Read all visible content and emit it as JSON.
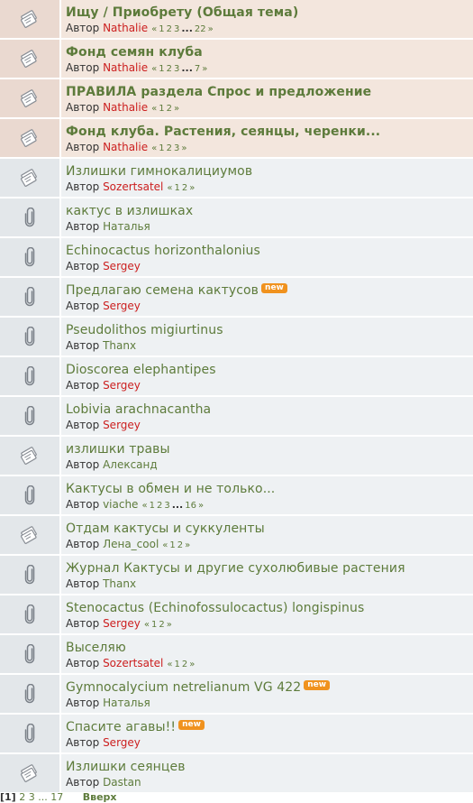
{
  "topics": [
    {
      "type": "sticky",
      "icon": "topic-sticky-icon",
      "title": "Ищу / Приобрету (Общая тема)",
      "author_label": "Автор",
      "author": "Nathalie",
      "author_color": "#cc1f1f",
      "pages": [
        "«",
        "1",
        "2",
        "3",
        "...",
        "22",
        "»"
      ],
      "badge": ""
    },
    {
      "type": "sticky",
      "icon": "topic-sticky-icon",
      "title": "Фонд семян клуба",
      "author_label": "Автор",
      "author": "Nathalie",
      "author_color": "#cc1f1f",
      "pages": [
        "«",
        "1",
        "2",
        "3",
        "...",
        "7",
        "»"
      ],
      "badge": ""
    },
    {
      "type": "sticky",
      "icon": "topic-sticky-icon",
      "title": "ПРАВИЛА раздела Спрос и предложение",
      "author_label": "Автор",
      "author": "Nathalie",
      "author_color": "#cc1f1f",
      "pages": [
        "«",
        "1",
        "2",
        "»"
      ],
      "badge": ""
    },
    {
      "type": "sticky",
      "icon": "topic-sticky-icon",
      "title": "Фонд клуба. Растения, сеянцы, черенки...",
      "author_label": "Автор",
      "author": "Nathalie",
      "author_color": "#cc1f1f",
      "pages": [
        "«",
        "1",
        "2",
        "3",
        "»"
      ],
      "badge": ""
    },
    {
      "type": "normal",
      "icon": "topic-multipage-icon",
      "title": "Излишки гимнокалициумов",
      "author_label": "Автор",
      "author": "Sozertsatel",
      "author_color": "#cc1f1f",
      "pages": [
        "«",
        "1",
        "2",
        "»"
      ],
      "badge": ""
    },
    {
      "type": "normal",
      "icon": "paperclip-icon",
      "title": "кактус в излишках",
      "author_label": "Автор",
      "author": "Наталья",
      "author_color": "#5d7b3b",
      "pages": [],
      "badge": ""
    },
    {
      "type": "normal",
      "icon": "paperclip-icon",
      "title": "Echinocactus horizonthalonius",
      "author_label": "Автор",
      "author": "Sergey",
      "author_color": "#cc1f1f",
      "pages": [],
      "badge": ""
    },
    {
      "type": "normal",
      "icon": "paperclip-icon",
      "title": "Предлагаю семена кактусов",
      "author_label": "Автор",
      "author": "Sergey",
      "author_color": "#cc1f1f",
      "pages": [],
      "badge": "new"
    },
    {
      "type": "normal",
      "icon": "paperclip-icon",
      "title": "Pseudolithos migiurtinus",
      "author_label": "Автор",
      "author": "Thanx",
      "author_color": "#5d7b3b",
      "pages": [],
      "badge": ""
    },
    {
      "type": "normal",
      "icon": "paperclip-icon",
      "title": "Dioscorea elephantipes",
      "author_label": "Автор",
      "author": "Sergey",
      "author_color": "#cc1f1f",
      "pages": [],
      "badge": ""
    },
    {
      "type": "normal",
      "icon": "paperclip-icon",
      "title": "Lobivia arachnacantha",
      "author_label": "Автор",
      "author": "Sergey",
      "author_color": "#cc1f1f",
      "pages": [],
      "badge": ""
    },
    {
      "type": "normal",
      "icon": "topic-multipage-icon",
      "title": "излишки травы",
      "author_label": "Автор",
      "author": "Александ",
      "author_color": "#5d7b3b",
      "pages": [],
      "badge": ""
    },
    {
      "type": "normal",
      "icon": "paperclip-icon",
      "title": "Кактусы в обмен и не только...",
      "author_label": "Автор",
      "author": "viache",
      "author_color": "#5d7b3b",
      "pages": [
        "«",
        "1",
        "2",
        "3",
        "...",
        "16",
        "»"
      ],
      "badge": ""
    },
    {
      "type": "normal",
      "icon": "topic-multipage-icon",
      "title": "Отдам кактусы и суккуленты",
      "author_label": "Автор",
      "author": "Лена_cool",
      "author_color": "#5d7b3b",
      "pages": [
        "«",
        "1",
        "2",
        "»"
      ],
      "badge": ""
    },
    {
      "type": "normal",
      "icon": "paperclip-icon",
      "title": "Журнал Кактусы и другие сухолюбивые растения",
      "author_label": "Автор",
      "author": "Thanx",
      "author_color": "#5d7b3b",
      "pages": [],
      "badge": ""
    },
    {
      "type": "normal",
      "icon": "paperclip-icon",
      "title": "Stenocactus (Echinofossulocactus) longispinus",
      "author_label": "Автор",
      "author": "Sergey",
      "author_color": "#cc1f1f",
      "pages": [
        "«",
        "1",
        "2",
        "»"
      ],
      "badge": ""
    },
    {
      "type": "normal",
      "icon": "paperclip-icon",
      "title": "Выселяю",
      "author_label": "Автор",
      "author": "Sozertsatel",
      "author_color": "#cc1f1f",
      "pages": [
        "«",
        "1",
        "2",
        "»"
      ],
      "badge": ""
    },
    {
      "type": "normal",
      "icon": "paperclip-icon",
      "title": "Gymnocalycium netrelianum VG 422",
      "author_label": "Автор",
      "author": "Наталья",
      "author_color": "#5d7b3b",
      "pages": [],
      "badge": "new"
    },
    {
      "type": "normal",
      "icon": "paperclip-icon",
      "title": "Спасите агавы!!",
      "author_label": "Автор",
      "author": "Sergey",
      "author_color": "#cc1f1f",
      "pages": [],
      "badge": "new"
    },
    {
      "type": "normal",
      "icon": "topic-multipage-icon",
      "title": "Излишки сеянцев",
      "author_label": "Автор",
      "author": "Dastan",
      "author_color": "#5d7b3b",
      "pages": [],
      "badge": ""
    }
  ],
  "pagination": {
    "current": "[1]",
    "pages": [
      "2",
      "3",
      "...",
      "17"
    ],
    "top_link": "Вверх"
  },
  "colors": {
    "title": "#5d7b3b",
    "author_highlight": "#cc1f1f",
    "badge": "#f0921e",
    "sticky_bg": "#f3e6dd",
    "normal_bg": "#eef1f3"
  }
}
